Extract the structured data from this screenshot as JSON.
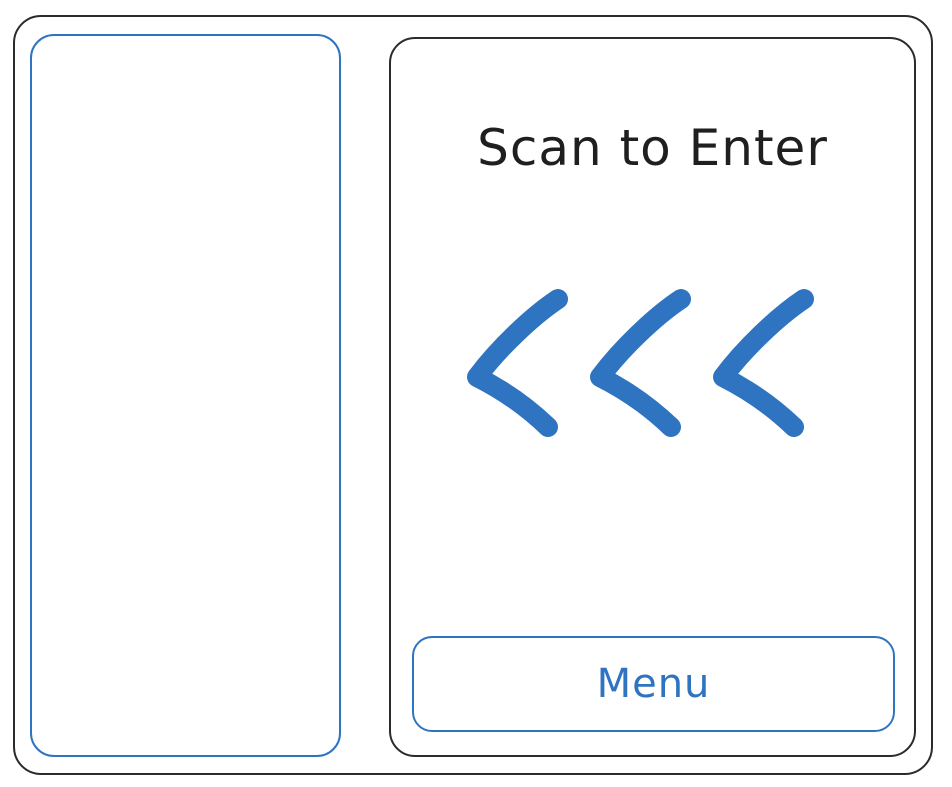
{
  "screen": {
    "title": "Scan to Enter",
    "direction_icon": "triple-chevron-left-icon",
    "menu_label": "Menu"
  },
  "colors": {
    "accent": "#2f74c0",
    "outline": "#2b2b2b",
    "text": "#1f1f1f",
    "background": "#ffffff"
  }
}
